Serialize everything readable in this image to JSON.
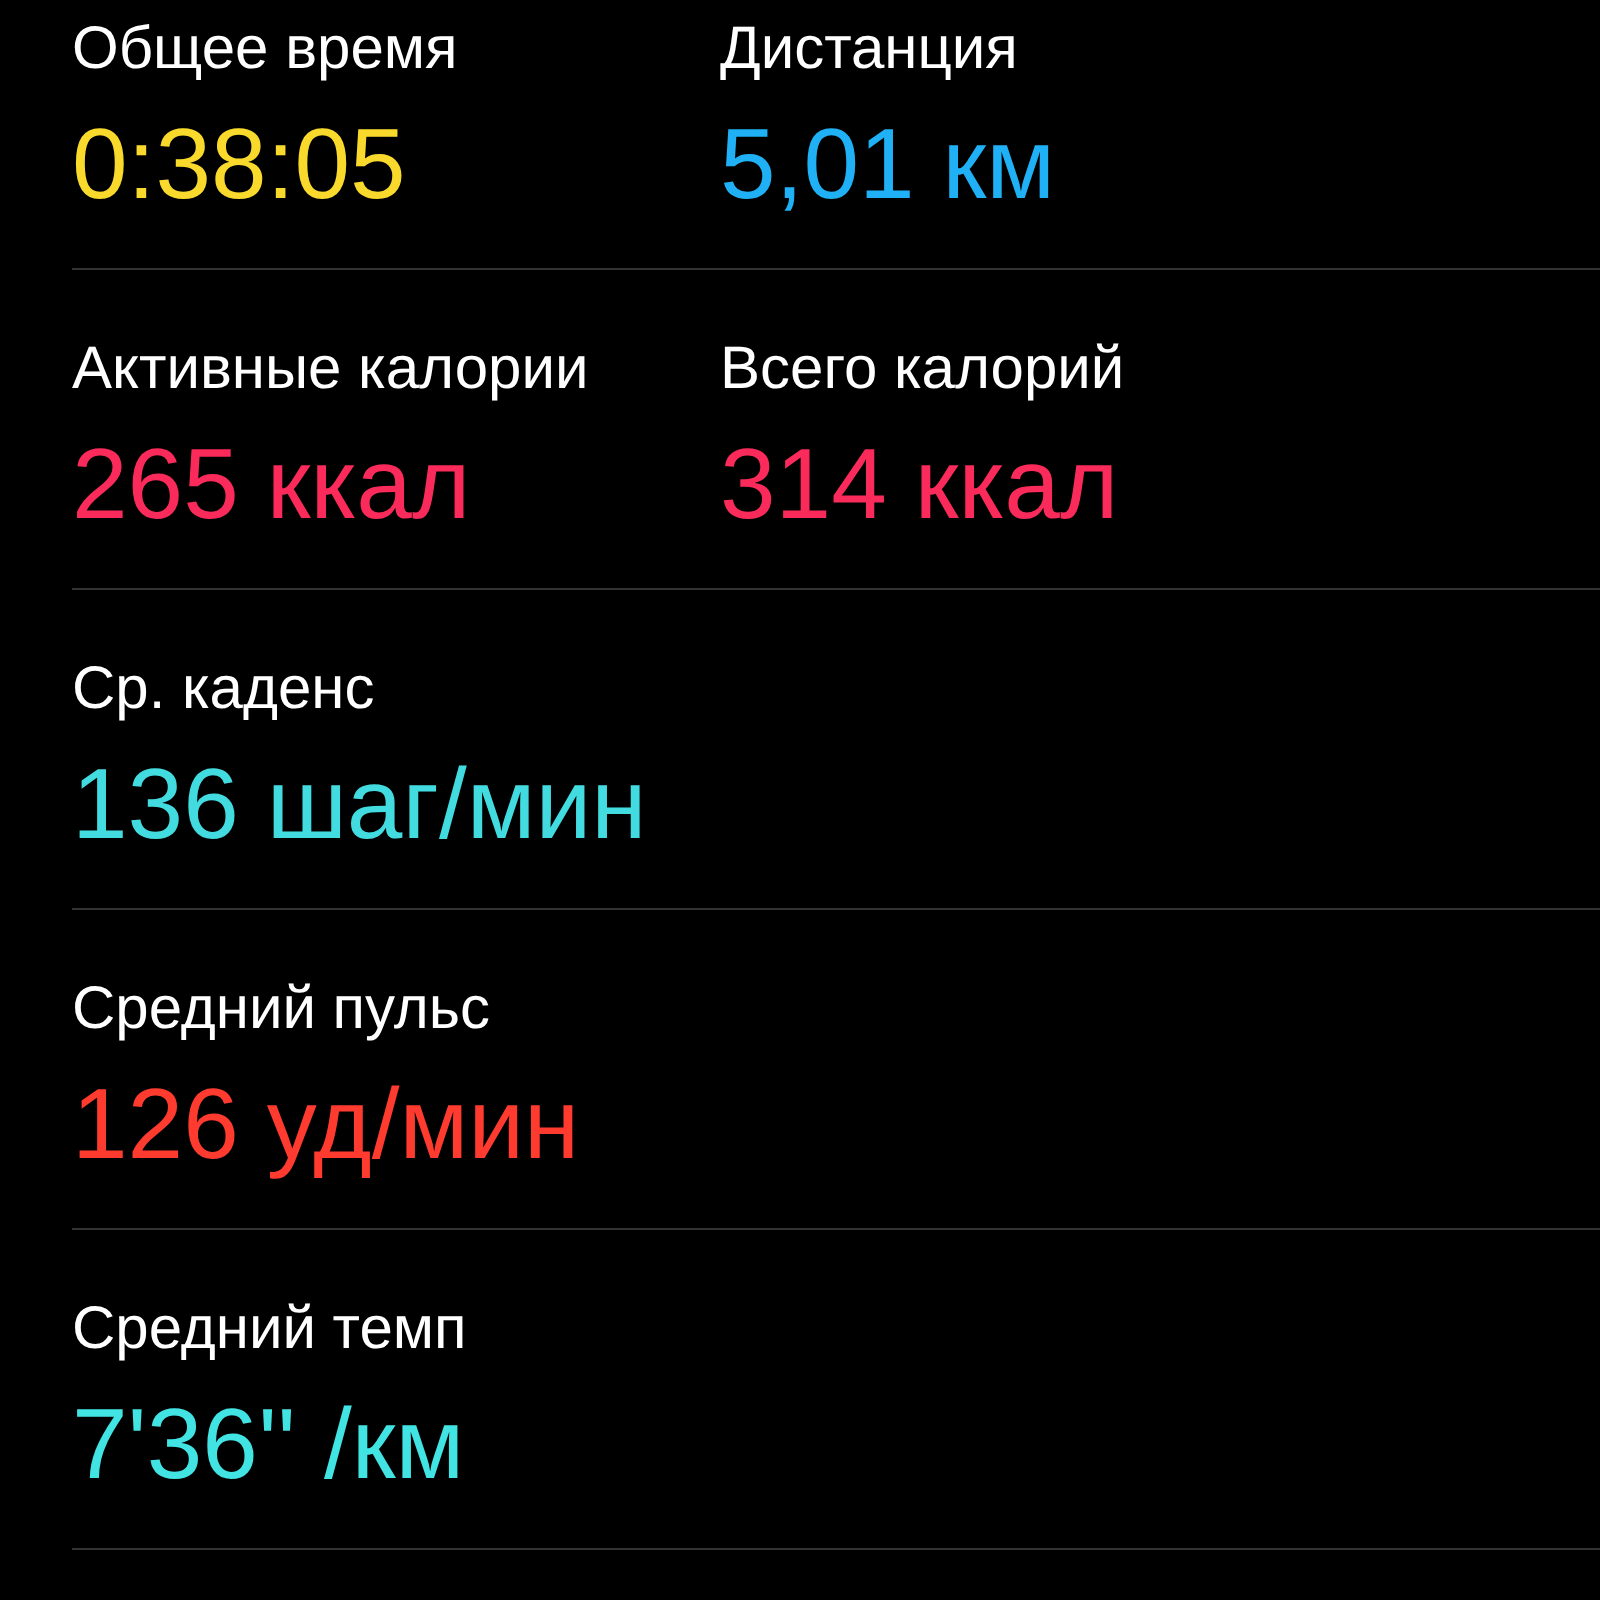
{
  "rows": [
    {
      "metrics": [
        {
          "label": "Общее время",
          "value": "0:38:05",
          "color": "#f9da2c"
        },
        {
          "label": "Дистанция",
          "value": "5,01 км",
          "color": "#1fb0f5"
        }
      ]
    },
    {
      "metrics": [
        {
          "label": "Активные калории",
          "value": "265 ккал",
          "color": "#fa2b5a"
        },
        {
          "label": "Всего калорий",
          "value": "314 ккал",
          "color": "#fa2b5a"
        }
      ]
    },
    {
      "metrics": [
        {
          "label": "Ср. каденс",
          "value": "136 шаг/мин",
          "color": "#41dbe0"
        }
      ]
    },
    {
      "metrics": [
        {
          "label": "Средний пульс",
          "value": "126 уд/мин",
          "color": "#ff3b2f"
        }
      ]
    },
    {
      "metrics": [
        {
          "label": "Средний темп",
          "value": "7'36'' /км",
          "color": "#41e3e3"
        }
      ]
    }
  ]
}
